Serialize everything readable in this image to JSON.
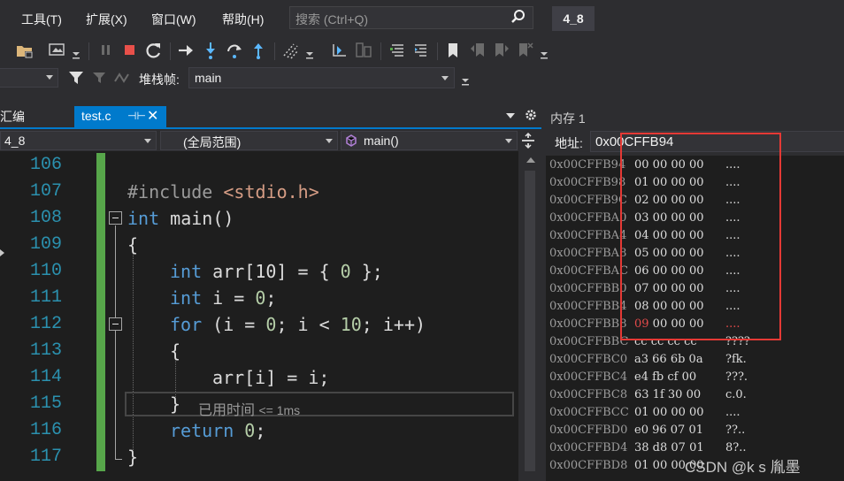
{
  "menu": {
    "items": [
      "工具(T)",
      "扩展(X)",
      "窗口(W)",
      "帮助(H)"
    ],
    "search_placeholder": "搜索 (Ctrl+Q)",
    "solution_name": "4_8"
  },
  "toolbar": {
    "stack_frame_label": "堆栈帧:",
    "stack_frame_value": "main"
  },
  "editor": {
    "tabs": [
      {
        "label": "汇编",
        "active": false
      },
      {
        "label": "test.c",
        "active": true
      }
    ],
    "nav": {
      "project": "4_8",
      "scope": "(全局范围)",
      "function": "main()"
    },
    "line_numbers": [
      "106",
      "107",
      "108",
      "109",
      "110",
      "111",
      "112",
      "113",
      "114",
      "115",
      "116",
      "117"
    ],
    "code": {
      "l107_pp": "#include",
      "l107_inc": "<stdio.h>",
      "l108_kw": "int",
      "l108_rest": "main()",
      "l109": "{",
      "l110_kw": "int",
      "l110_rest": "arr[10] = { ",
      "l110_num": "0",
      "l110_end": " };",
      "l111_kw": "int",
      "l111_rest": "i = ",
      "l111_num": "0",
      "l111_end": ";",
      "l112_kw": "for",
      "l112_a": "(i = ",
      "l112_n1": "0",
      "l112_b": "; i < ",
      "l112_n2": "10",
      "l112_c": "; i++)",
      "l113": "{",
      "l114": "arr[i] = i;",
      "l115": "}",
      "l116_kw": "return",
      "l116_num": "0",
      "l116_end": ";",
      "l117": "}"
    },
    "elapsed_label": "已用时间",
    "elapsed_value": "<= 1ms"
  },
  "memory": {
    "title": "内存 1",
    "address_label": "地址:",
    "address_value": "0x00CFFB94",
    "rows": [
      {
        "addr": "0x00CFFB94",
        "bytes": "00 00 00 00",
        "chars": "...."
      },
      {
        "addr": "0x00CFFB98",
        "bytes": "01 00 00 00",
        "chars": "...."
      },
      {
        "addr": "0x00CFFB9C",
        "bytes": "02 00 00 00",
        "chars": "...."
      },
      {
        "addr": "0x00CFFBA0",
        "bytes": "03 00 00 00",
        "chars": "...."
      },
      {
        "addr": "0x00CFFBA4",
        "bytes": "04 00 00 00",
        "chars": "...."
      },
      {
        "addr": "0x00CFFBA8",
        "bytes": "05 00 00 00",
        "chars": "...."
      },
      {
        "addr": "0x00CFFBAC",
        "bytes": "06 00 00 00",
        "chars": "...."
      },
      {
        "addr": "0x00CFFBB0",
        "bytes": "07 00 00 00",
        "chars": "...."
      },
      {
        "addr": "0x00CFFBB4",
        "bytes": "08 00 00 00",
        "chars": "...."
      },
      {
        "addr": "0x00CFFBB8",
        "bytes_changed": "09",
        "bytes_rest": " 00 00 00",
        "chars": "....",
        "changed": true
      },
      {
        "addr": "0x00CFFBBC",
        "bytes": "cc cc cc cc",
        "chars": "????"
      },
      {
        "addr": "0x00CFFBC0",
        "bytes": "a3 66 6b 0a",
        "chars": "?fk."
      },
      {
        "addr": "0x00CFFBC4",
        "bytes": "e4 fb cf 00",
        "chars": "???."
      },
      {
        "addr": "0x00CFFBC8",
        "bytes": "63 1f 30 00",
        "chars": "c.0."
      },
      {
        "addr": "0x00CFFBCC",
        "bytes": "01 00 00 00",
        "chars": "...."
      },
      {
        "addr": "0x00CFFBD0",
        "bytes": "e0 96 07 01",
        "chars": "??.."
      },
      {
        "addr": "0x00CFFBD4",
        "bytes": "38 d8 07 01",
        "chars": "8?.."
      },
      {
        "addr": "0x00CFFBD8",
        "bytes": "01 00 00 00",
        "chars": ""
      }
    ]
  },
  "watermark": "CSDN @k s 胤墨",
  "colors": {
    "accent": "#007acc",
    "highlight_box": "#e53935",
    "changed_value": "#e34a4a",
    "keyword": "#569cd6",
    "line_number": "#2b91af"
  }
}
